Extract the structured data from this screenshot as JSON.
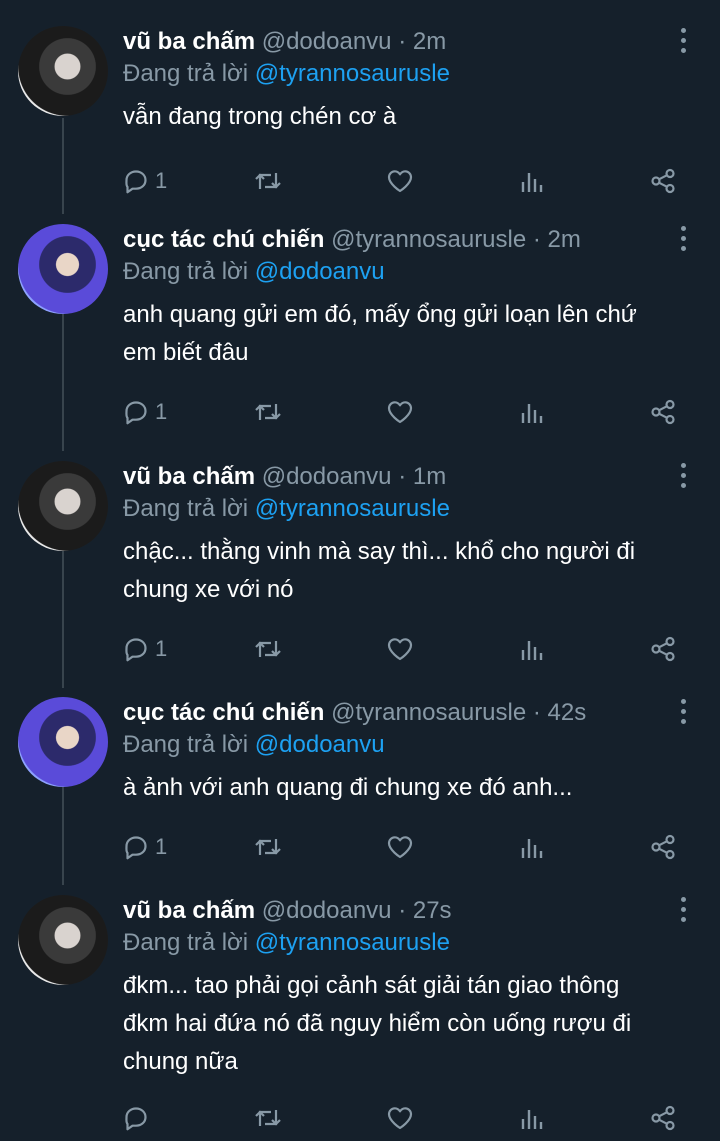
{
  "tweets": [
    {
      "name": "vũ ba chấm",
      "handle": "@dodoanvu",
      "time": "· 2m",
      "reply_prefix": "Đang trả lời",
      "reply_to": "@tyrannosaurusle",
      "lines": [
        "vẫn đang trong chén cơ à"
      ],
      "reply_count": "1"
    },
    {
      "name": "cục tác chú chiến",
      "handle": "@tyrannosaurusle",
      "time": "· 2m",
      "reply_prefix": "Đang trả lời",
      "reply_to": "@dodoanvu",
      "lines": [
        "anh quang gửi em đó, mấy ổng gửi loạn lên chứ",
        "em biết đâu"
      ],
      "reply_count": "1"
    },
    {
      "name": "vũ ba chấm",
      "handle": "@dodoanvu",
      "time": "· 1m",
      "reply_prefix": "Đang trả lời",
      "reply_to": "@tyrannosaurusle",
      "lines": [
        "chậc... thằng vinh mà say thì... khổ cho người đi",
        "chung xe với nó"
      ],
      "reply_count": "1"
    },
    {
      "name": "cục tác chú chiến",
      "handle": "@tyrannosaurusle",
      "time": "· 42s",
      "reply_prefix": "Đang trả lời",
      "reply_to": "@dodoanvu",
      "lines": [
        "à ảnh với anh quang đi chung xe đó anh..."
      ],
      "reply_count": "1"
    },
    {
      "name": "vũ ba chấm",
      "handle": "@dodoanvu",
      "time": "· 27s",
      "reply_prefix": "Đang trả lời",
      "reply_to": "@tyrannosaurusle",
      "lines": [
        "đkm... tao phải gọi cảnh sát giải tán giao thông",
        "đkm hai đứa nó đã nguy hiểm còn uống rượu đi",
        "chung nữa"
      ],
      "reply_count": ""
    }
  ],
  "icons": {
    "reply": "reply-icon",
    "retweet": "retweet-icon",
    "like": "heart-icon",
    "analytics": "analytics-icon",
    "share": "share-icon",
    "more": "more-vertical-icon"
  },
  "colors": {
    "background": "#15202b",
    "secondary_text": "#8899a6",
    "mention": "#1da1f2",
    "thread_line": "#38444d"
  }
}
